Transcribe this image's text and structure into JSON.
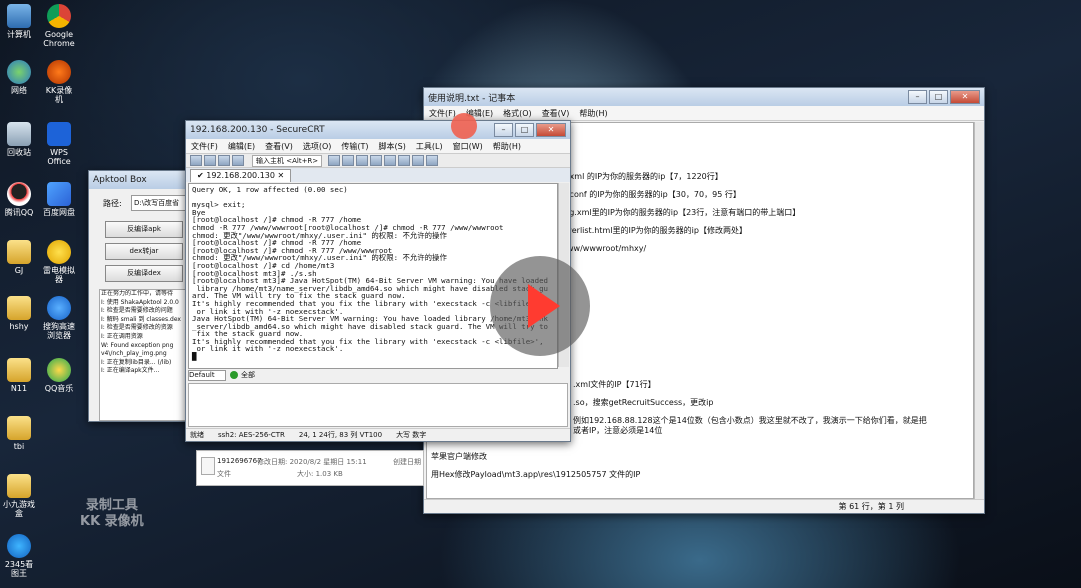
{
  "desktop": {
    "icons": [
      {
        "label": "计算机",
        "icon": "computer-icon"
      },
      {
        "label": "Google Chrome",
        "icon": "chrome-icon"
      },
      {
        "label": "网络",
        "icon": "network-icon"
      },
      {
        "label": "KK录像机",
        "icon": "kk-recorder-icon"
      },
      {
        "label": "回收站",
        "icon": "recycle-bin-icon"
      },
      {
        "label": "WPS Office",
        "icon": "wps-icon"
      },
      {
        "label": "腾讯QQ",
        "icon": "qq-icon"
      },
      {
        "label": "百度网盘",
        "icon": "baidu-netdisk-icon"
      },
      {
        "label": "GJ",
        "icon": "folder-icon"
      },
      {
        "label": "雷电模拟器",
        "icon": "ldplayer-icon"
      },
      {
        "label": "hshy",
        "icon": "folder-icon"
      },
      {
        "label": "搜狗高速浏览器",
        "icon": "sogou-browser-icon"
      },
      {
        "label": "N11",
        "icon": "folder-icon"
      },
      {
        "label": "QQ音乐",
        "icon": "qq-music-icon"
      },
      {
        "label": "tbi",
        "icon": "folder-icon"
      },
      {
        "label": "小九游戏盒",
        "icon": "folder-icon"
      },
      {
        "label": "2345看图王",
        "icon": "2345-icon"
      }
    ]
  },
  "notepad": {
    "title": "使用说明.txt - 记事本",
    "menu": [
      "文件(F)",
      "编辑(E)",
      "格式(O)",
      "查看(V)",
      "帮助(H)"
    ],
    "lines": [
      ".xml 的IP为你的服务器的ip【7，1220行】",
      ".conf 的IP为你的服务器的ip【30，70，95 行】",
      "ig.xml里的IP为你的服务器的ip【23行，注意有端口的带上端口】",
      "verlist.html里的IP为你的服务器的ip【修改两处】",
      "ww/wwwroot/mhxy/",
      ".xml文件的IP【71行】",
      ".so，搜索getRecruitSuccess，更改ip",
      "例如192.168.88.128这个是14位数（包含小数点）我这里就不改了，我演示一下给你们看，就是把",
      "或者IP，注意必须是14位",
      "苹果官户端修改",
      "用Hex修改Payload\\mt3.app\\res\\1912505757 文件的IP"
    ],
    "status": "第 61 行，第 1 列"
  },
  "securecrt": {
    "title": "192.168.200.130 - SecureCRT",
    "menu": [
      "文件(F)",
      "编辑(E)",
      "查看(V)",
      "选项(O)",
      "传输(T)",
      "脚本(S)",
      "工具(L)",
      "窗口(W)",
      "帮助(H)"
    ],
    "toolbar_input": "输入主机 <Alt+R>",
    "tab": "192.168.200.130",
    "terminal": "Query OK, 1 row affected (0.00 sec)\n\nmysql> exit;\nBye\n[root@localhost /]# chmod -R 777 /home\nchmod -R 777 /www/wwwroot[root@localhost /]# chmod -R 777 /www/wwwroot\nchmod: 更改\"/www/wwwroot/mhxy/.user.ini\" 的权限: 不允许的操作\n[root@localhost /]# chmod -R 777 /home\n[root@localhost /]# chmod -R 777 /www/wwwroot\nchmod: 更改\"/www/wwwroot/mhxy/.user.ini\" 的权限: 不允许的操作\n[root@localhost /]# cd /home/mt3\n[root@localhost mt3]# ./s.sh\n[root@localhost mt3]# Java HotSpot(TM) 64-Bit Server VM warning: You have loaded\n library /home/mt3/name_server/libdb_amd64.so which might have disabled stack gu\nard. The VM will try to fix the stack guard now.\nIt's highly recommended that you fix the library with 'execstack -c <libfile>',\n or link it with '-z noexecstack'.\nJava HotSpot(TM) 64-Bit Server VM warning: You have loaded library /home/mt3/unk\n_server/libdb_amd64.so which might have disabled stack guard. The VM will try to\n fix the stack guard now.\nIt's highly recommended that you fix the library with 'execstack -c <libfile>',\n or link it with '-z noexecstack'.\n█",
    "session_selector": "Default",
    "session_label": "全部",
    "status": [
      "就绪",
      "ssh2: AES-256-CTR",
      "24, 1  24行, 83 列 VT100",
      "大写 数字"
    ]
  },
  "apktool": {
    "title": "Apktool Box",
    "path_label": "路径:",
    "path_value": "D:\\改写百度省",
    "buttons": [
      "反编译apk",
      "dex转jar",
      "反编译dex"
    ],
    "log": [
      "正在努力的工作中，请等待",
      "I: 使用 ShakaApktool 2.0.0",
      "I: 检查是否需要修改的问题",
      "I: 解码 smali 到 classes.dex",
      "I: 检查是否需要修改的资源",
      "I: 正在调用资源",
      "W: Found exception png",
      "v4\\/nch_play_img.png",
      "I: 正在复制lib目录... (/lib)",
      "I: 正在编译apk文件..."
    ]
  },
  "fileinfo": {
    "name": "1912696767",
    "modified_label": "修改日期: 2020/8/2 星期日 15:11",
    "created_label": "创建日期",
    "type": "文件",
    "size": "大小: 1.03 KB"
  },
  "watermark": {
    "line1": "录制工具",
    "line2": "KK 录像机"
  },
  "colors": {
    "accent_play": "#ff3b30",
    "terminal_bg": "#ffffff"
  }
}
